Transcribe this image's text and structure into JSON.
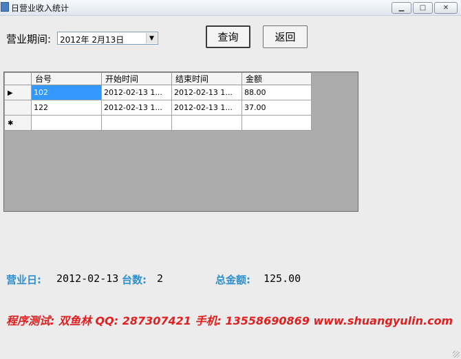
{
  "window": {
    "title": "日营业收入统计",
    "controls": {
      "minimize": "▁",
      "maximize": "□",
      "close": "✕"
    }
  },
  "filter": {
    "period_label": "营业期间:",
    "date_value": "2012年  2月13日",
    "dropdown_glyph": "▼"
  },
  "buttons": {
    "query": "查询",
    "back": "返回"
  },
  "grid": {
    "columns": [
      "台号",
      "开始时间",
      "结束时间",
      "金额"
    ],
    "rows": [
      {
        "marker": "▶",
        "cells": [
          "102",
          "2012-02-13 1...",
          "2012-02-13 1...",
          "88.00"
        ],
        "selected_cell": 0
      },
      {
        "marker": "",
        "cells": [
          "122",
          "2012-02-13 1...",
          "2012-02-13 1...",
          "37.00"
        ]
      },
      {
        "marker": "✱",
        "cells": [
          "",
          "",
          "",
          ""
        ]
      }
    ]
  },
  "summary": {
    "day_label": "营业日:",
    "day_value": "2012-02-13",
    "count_label": "台数:",
    "count_value": "2",
    "total_label": "总金额:",
    "total_value": "125.00"
  },
  "credit": "程序测试: 双鱼林    QQ: 287307421    手机: 13558690869    www.shuangyulin.com",
  "colors": {
    "label_blue": "#2d8fd0",
    "credit_red": "#e02020",
    "selection": "#3399ff",
    "grid_bg": "#ababab"
  }
}
